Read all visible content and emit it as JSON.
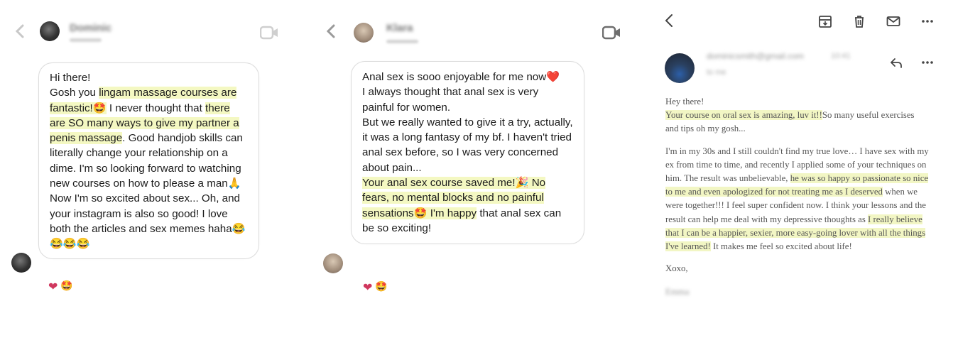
{
  "panel1": {
    "contact_name": "Dominic",
    "contact_status": "Active",
    "message_paragraphs": [
      [
        {
          "t": "Hi there!",
          "hl": false
        }
      ],
      [
        {
          "t": "Gosh you ",
          "hl": false
        },
        {
          "t": "lingam massage courses are fantastic!",
          "hl": true
        },
        {
          "t": "🤩",
          "hl": true
        },
        {
          "t": " I never thought that ",
          "hl": false
        },
        {
          "t": "there are SO many ways to give my partner a penis massage",
          "hl": true
        },
        {
          "t": ". Good handjob skills can literally change your relationship on a dime. I'm so looking forward to watching new courses on how to please a man🙏",
          "hl": false
        }
      ],
      [
        {
          "t": "Now I'm so excited about sex... Oh, and your instagram is also so good! I love both the articles and sex memes haha😂😂😂😂",
          "hl": false
        }
      ]
    ],
    "reactions": [
      "❤",
      "🤩"
    ]
  },
  "panel2": {
    "contact_name": "Klara",
    "contact_status": "Active",
    "message_paragraphs": [
      [
        {
          "t": "Anal sex is sooo enjoyable for me now❤️",
          "hl": false
        }
      ],
      [
        {
          "t": "I always thought that anal sex is very painful for women.",
          "hl": false
        }
      ],
      [
        {
          "t": "But we really wanted to give it a try, actually, it was a long fantasy of my bf. I haven't tried anal sex before, so I was very concerned about pain...",
          "hl": false
        }
      ],
      [
        {
          "t": "Your anal sex course saved me!🎉 No fears, no mental blocks and no painful sensations🤩 I'm happy",
          "hl": true
        },
        {
          "t": " that anal sex can be so exciting!",
          "hl": false
        }
      ]
    ],
    "reactions": [
      "❤",
      "🤩"
    ]
  },
  "panel3": {
    "sender_email": "dominicsmith@gmail.com",
    "sender_time": "10:41",
    "sender_to": "to me",
    "greeting": "Hey there!",
    "paragraphs": [
      [
        {
          "t": "Your course on oral sex is amazing, luv it!!",
          "hl": true
        },
        {
          "t": "So many useful exercises and tips oh my gosh...",
          "hl": false
        }
      ],
      [
        {
          "t": "I'm in my 30s and I still couldn't find my true love… I have sex with my ex from time to time, and recently I applied some of your techniques on him. The result was unbelievable, ",
          "hl": false
        },
        {
          "t": "he was so happy so passionate so nice to me and even apologized for not treating me as I deserved",
          "hl": true
        },
        {
          "t": " when we were together!!!  I feel super confident now. I think your lessons and the result can help me deal with my depressive thoughts as ",
          "hl": false
        },
        {
          "t": "I really believe that I can be a happier, sexier, more easy-going lover with all the things I've learned!",
          "hl": true
        },
        {
          "t": " It makes me feel so excited about life!",
          "hl": false
        }
      ]
    ],
    "signoff": "Xoxo,",
    "signature": "Emma"
  }
}
